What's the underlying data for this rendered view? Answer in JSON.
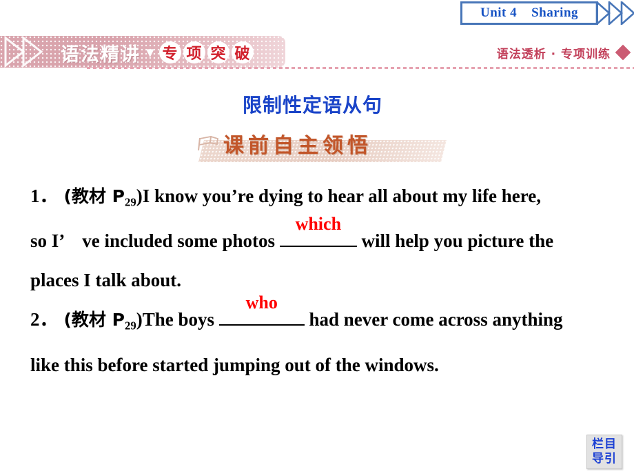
{
  "header": {
    "unit_label": "Unit 4    Sharing",
    "chevron_icon": "double-chevron-right-icon"
  },
  "section_banner": {
    "left_text_plain": "语法精讲",
    "separator": "▼",
    "circled_chars": [
      "专",
      "项",
      "突",
      "破"
    ],
    "right_text": "语法透析 · 专项训练",
    "chevron_icon": "double-chevron-right-icon",
    "diamond_icon": "diamond-ornament-icon",
    "colors": {
      "banner_pink": "#d9a4ad",
      "circle_red": "#d1202c",
      "right_text_red": "#c2405a"
    }
  },
  "title": {
    "text": "限制性定语从句",
    "color": "#1a44c8"
  },
  "sub_banner": {
    "text": "课前自主领悟",
    "flag_icon": "flag-icon",
    "color": "#c2562a"
  },
  "content": {
    "items": [
      {
        "index": "1．",
        "source_prefix": "(教材 P",
        "source_page": "29",
        "source_suffix": ")",
        "segments": [
          "I know you’re dying to hear all about my life here,",
          "so I’　ve included some photos ",
          " will help you picture the",
          "places I talk about."
        ],
        "answer": "which",
        "answer_color": "#ff0000"
      },
      {
        "index": "2．",
        "source_prefix": "(教材 P",
        "source_page": "29",
        "source_suffix": ")",
        "segments": [
          "The boys ",
          " had never come across anything",
          "like this before started jumping out of the windows."
        ],
        "answer": "who",
        "answer_color": "#ff0000"
      }
    ]
  },
  "footer": {
    "nav_line1": "栏目",
    "nav_line2": "导引",
    "color": "#1a3fd4"
  }
}
